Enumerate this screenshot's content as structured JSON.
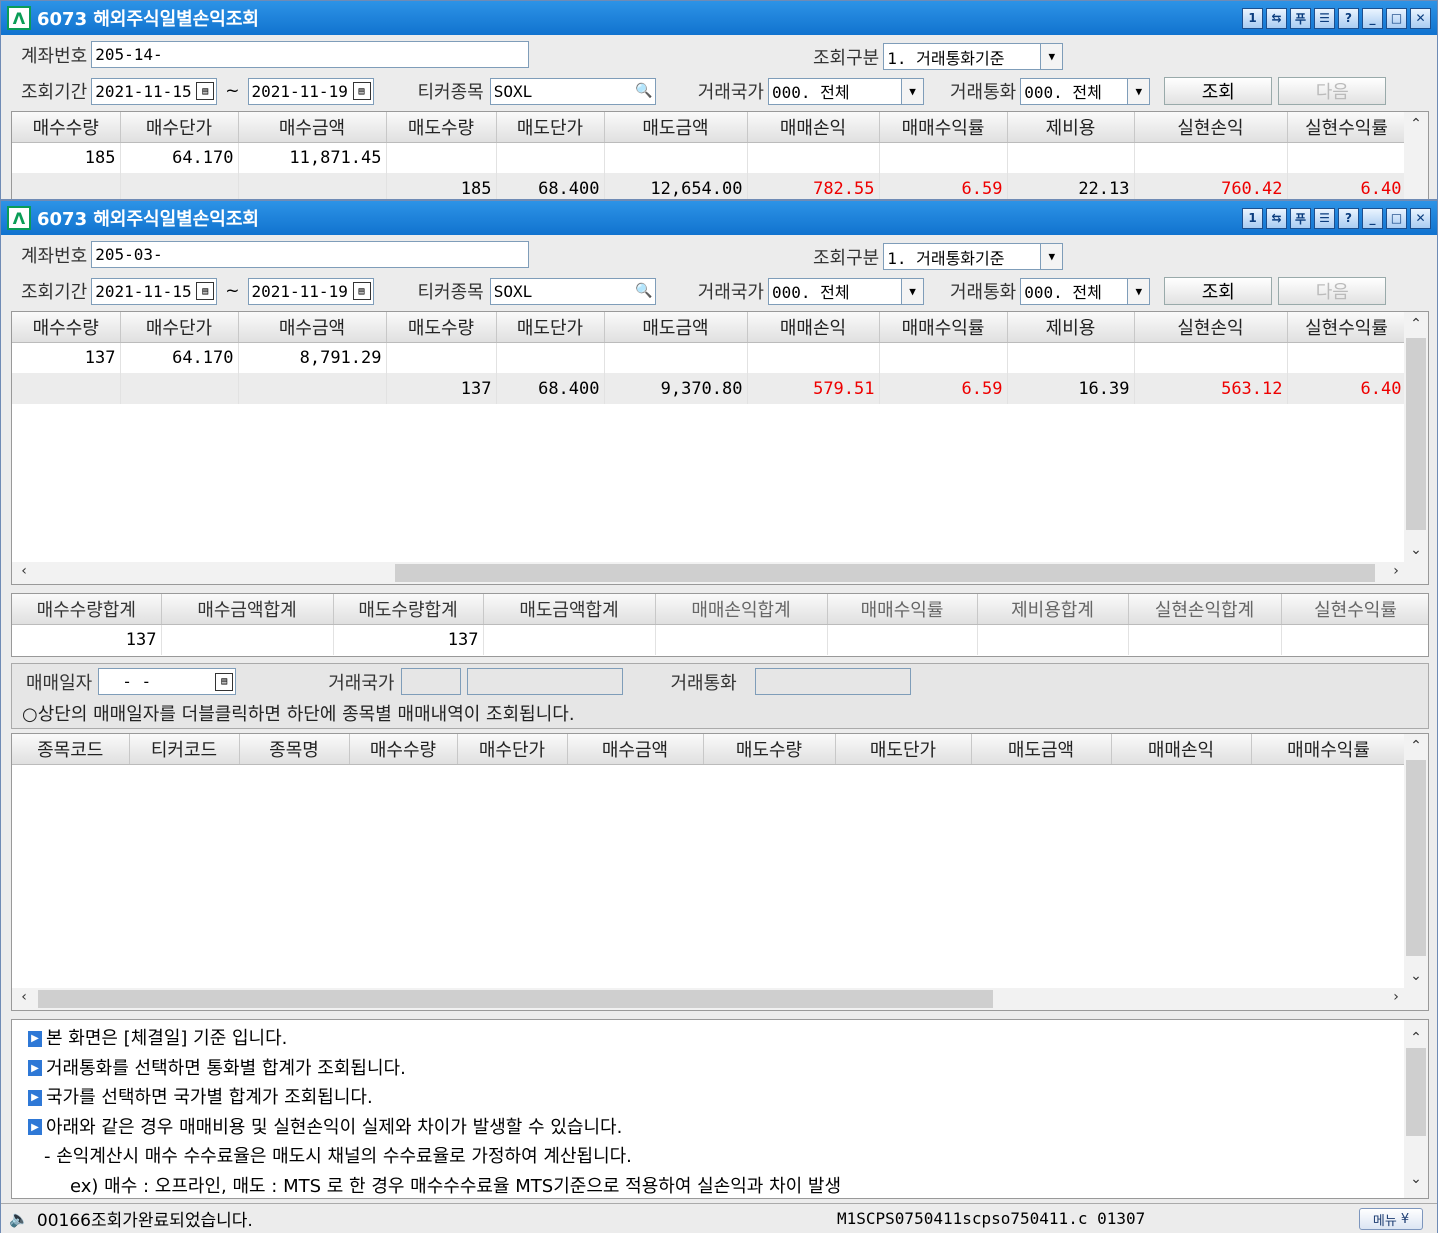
{
  "window1": {
    "title": "6073 해외주식일별손익조회",
    "account_label": "계좌번호",
    "account_value": "205-14-",
    "query_type_label": "조회구분",
    "query_type_value": "1. 거래통화기준",
    "period_label": "조회기간",
    "date_from": "2021-11-15",
    "tilde": "~",
    "date_to": "2021-11-19",
    "ticker_label": "티커종목",
    "ticker_value": "SOXL",
    "country_label": "거래국가",
    "country_value": "000. 전체",
    "currency_label": "거래통화",
    "currency_value": "000. 전체",
    "search_btn": "조회",
    "next_btn": "다음",
    "columns": [
      "매수수량",
      "매수단가",
      "매수금액",
      "매도수량",
      "매도단가",
      "매도금액",
      "매매손익",
      "매매수익률",
      "제비용",
      "실현손익",
      "실현수익률"
    ],
    "rows": [
      [
        "185",
        "64.170",
        "11,871.45",
        "",
        "",
        "",
        "",
        "",
        "",
        "",
        ""
      ],
      [
        "",
        "",
        "",
        "185",
        "68.400",
        "12,654.00",
        "782.55",
        "6.59",
        "22.13",
        "760.42",
        "6.40"
      ]
    ]
  },
  "window2": {
    "title": "6073 해외주식일별손익조회",
    "account_label": "계좌번호",
    "account_value": "205-03-",
    "query_type_label": "조회구분",
    "query_type_value": "1. 거래통화기준",
    "period_label": "조회기간",
    "date_from": "2021-11-15",
    "tilde": "~",
    "date_to": "2021-11-19",
    "ticker_label": "티커종목",
    "ticker_value": "SOXL",
    "country_label": "거래국가",
    "country_value": "000. 전체",
    "currency_label": "거래통화",
    "currency_value": "000. 전체",
    "search_btn": "조회",
    "next_btn": "다음",
    "columns": [
      "매수수량",
      "매수단가",
      "매수금액",
      "매도수량",
      "매도단가",
      "매도금액",
      "매매손익",
      "매매수익률",
      "제비용",
      "실현손익",
      "실현수익률"
    ],
    "rows": [
      [
        "137",
        "64.170",
        "8,791.29",
        "",
        "",
        "",
        "",
        "",
        "",
        "",
        ""
      ],
      [
        "",
        "",
        "",
        "137",
        "68.400",
        "9,370.80",
        "579.51",
        "6.59",
        "16.39",
        "563.12",
        "6.40"
      ]
    ],
    "summary_columns": [
      "매수수량합계",
      "매수금액합계",
      "매도수량합계",
      "매도금액합계",
      "매매손익합계",
      "매매수익률",
      "제비용합계",
      "실현손익합계",
      "실현수익률"
    ],
    "summary_values": [
      "137",
      "",
      "137",
      "",
      "",
      "",
      "",
      "",
      ""
    ],
    "trade_date_label": "매매일자",
    "trade_date_value": "- -",
    "detail_country_label": "거래국가",
    "detail_currency_label": "거래통화",
    "detail_hint": "○상단의 매매일자를 더블클릭하면 하단에 종목별 매매내역이 조회됩니다.",
    "detail_columns": [
      "종목코드",
      "티커코드",
      "종목명",
      "매수수량",
      "매수단가",
      "매수금액",
      "매도수량",
      "매도단가",
      "매도금액",
      "매매손익",
      "매매수익률"
    ],
    "notes": [
      "본 화면은 [체결일] 기준 입니다.",
      "거래통화를 선택하면 통화별 합계가 조회됩니다.",
      "국가를 선택하면 국가별 합계가 조회됩니다.",
      "아래와 같은 경우 매매비용 및 실현손익이 실제와 차이가 발생할 수 있습니다."
    ],
    "note_sub1": "- 손익계산시 매수 수수료율은 매도시 채널의 수수료율로 가정하여 계산됩니다.",
    "note_sub2": "ex) 매수 : 오프라인,  매도 : MTS 로 한 경우  매수수수료율 MTS기준으로 적용하여 실손익과 차이 발생",
    "status_message": "00166조회가완료되었습니다.",
    "status_code": "M1SCPS0750411scpso750411.c   01307",
    "menu_label": "메뉴"
  },
  "colors": {
    "title_bar": "#1173cf",
    "profit_red": "#e00000",
    "panel_bg": "#ececec"
  }
}
